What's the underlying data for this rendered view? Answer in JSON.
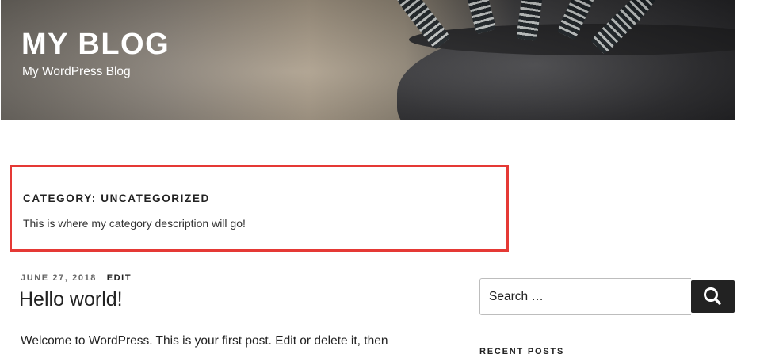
{
  "header": {
    "site_title": "MY BLOG",
    "tagline": "My WordPress Blog"
  },
  "archive": {
    "title": "CATEGORY: UNCATEGORIZED",
    "description": "This is where my category description will go!"
  },
  "post": {
    "date": "JUNE 27, 2018",
    "edit_label": "EDIT",
    "title": "Hello world!",
    "excerpt": "Welcome to WordPress. This is your first post. Edit or delete it, then"
  },
  "sidebar": {
    "search_placeholder": "Search …",
    "search_icon": "search-icon",
    "recent_posts_heading": "RECENT POSTS"
  },
  "colors": {
    "highlight_border": "#e53935",
    "search_button": "#222222"
  }
}
